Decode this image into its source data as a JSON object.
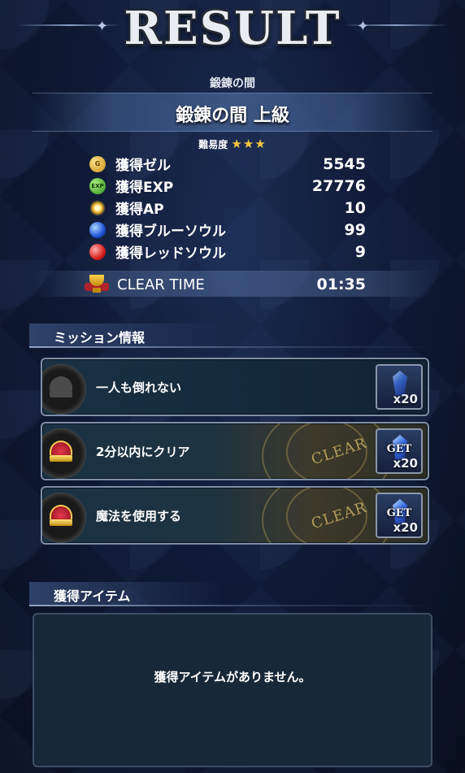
{
  "header": {
    "title": "RESULT"
  },
  "dungeon": {
    "name": "鍛錬の間",
    "stage": "鍛錬の間 上級",
    "difficulty_label": "難易度",
    "difficulty_stars": "★★★"
  },
  "rewards": [
    {
      "icon": "gil-coin-icon",
      "icon_text": "G",
      "label": "獲得ゼル",
      "value": "5545"
    },
    {
      "icon": "exp-icon",
      "icon_text": "EXP",
      "label": "獲得EXP",
      "value": "27776"
    },
    {
      "icon": "ap-icon",
      "icon_text": "",
      "label": "獲得AP",
      "value": "10"
    },
    {
      "icon": "blue-soul-icon",
      "icon_text": "",
      "label": "獲得ブルーソウル",
      "value": "99"
    },
    {
      "icon": "red-soul-icon",
      "icon_text": "",
      "label": "獲得レッドソウル",
      "value": "9"
    }
  ],
  "clear_time": {
    "icon": "trophy-icon",
    "label": "CLEAR TIME",
    "value": "01:35"
  },
  "missions_section": {
    "title": "ミッション情報"
  },
  "missions": [
    {
      "text": "一人も倒れない",
      "cleared": false,
      "stamp": "",
      "reward_tag": "",
      "reward_qty": "x20",
      "crown": "dark-crown-icon"
    },
    {
      "text": "2分以内にクリア",
      "cleared": true,
      "stamp": "CLEAR",
      "reward_tag": "GET",
      "reward_qty": "x20",
      "crown": "gold-crown-icon"
    },
    {
      "text": "魔法を使用する",
      "cleared": true,
      "stamp": "CLEAR",
      "reward_tag": "GET",
      "reward_qty": "x20",
      "crown": "gold-crown-icon"
    }
  ],
  "items_section": {
    "title": "獲得アイテム",
    "empty_message": "獲得アイテムがありません。"
  },
  "colors": {
    "star": "#f5c842",
    "background": "#0f1a36",
    "panel_border": "#7e8ea8"
  }
}
